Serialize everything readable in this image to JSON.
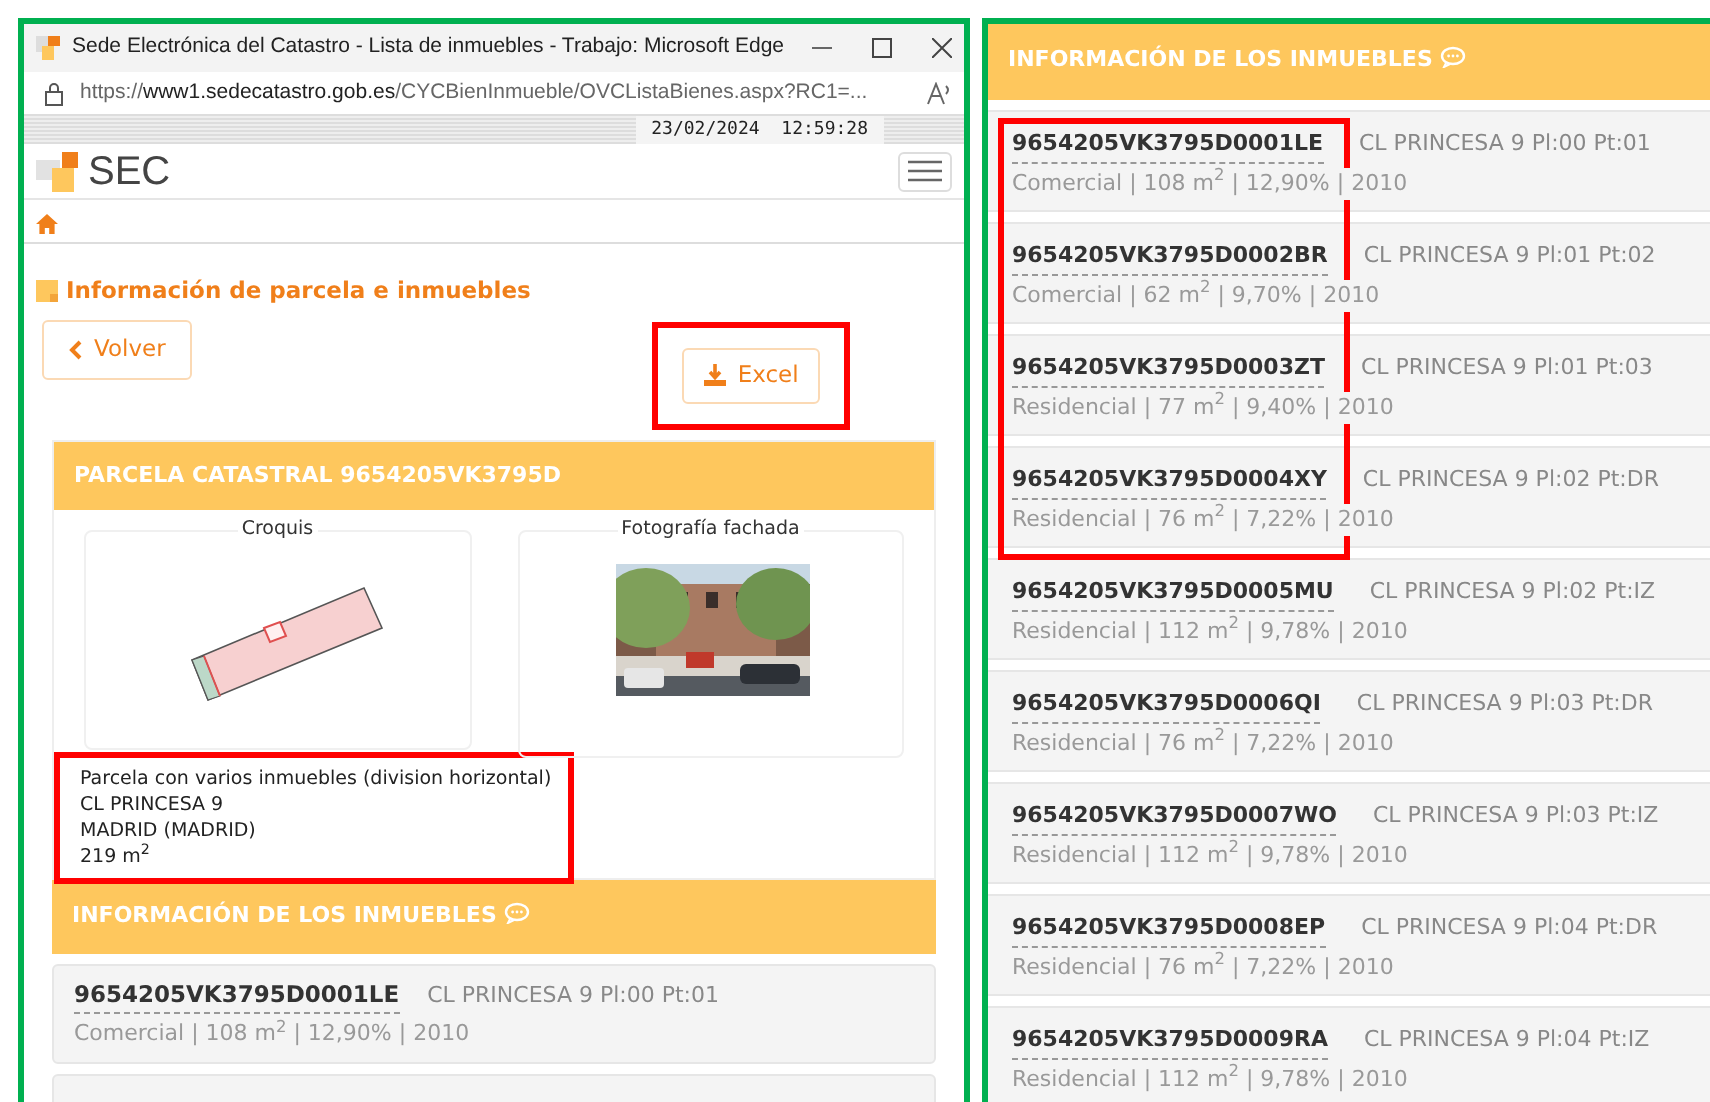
{
  "browser": {
    "title": "Sede Electrónica del Catastro - Lista de inmuebles - Trabajo: Microsoft Edge",
    "url_scheme": "https://",
    "url_host": "www1.sedecatastro.gob.es",
    "url_path": "/CYCBienInmueble/OVCListaBienes.aspx?RC1=...",
    "datetime": "23/02/2024  12:59:28"
  },
  "site": {
    "logo": "SEC",
    "section_title": "Información de parcela e inmuebles",
    "back_button": "Volver",
    "excel_button": {
      "label": "Excel",
      "highlighted": true
    }
  },
  "parcel": {
    "header": "PARCELA CATASTRAL 9654205VK3795D",
    "sketch_title": "Croquis",
    "photo_title": "Fotografía fachada",
    "info": {
      "highlighted": true,
      "lines": [
        "Parcela con varios inmuebles (division horizontal)",
        "CL PRINCESA 9",
        "MADRID (MADRID)",
        "219 m$^{2}$"
      ]
    }
  },
  "left_properties_header": "INFORMACIÓN DE LOS INMUEBLES",
  "right_properties_header": "INFORMACIÓN DE LOS INMUEBLES",
  "left_rows": [
    {
      "code": "9654205VK3795D0001LE",
      "address": "CL PRINCESA 9 Pl:00 Pt:01",
      "details": "Comercial | 108 m$^{2}$ | 12,90% | 2010"
    }
  ],
  "right_rows": [
    {
      "code": "9654205VK3795D0001LE",
      "address": "CL PRINCESA 9 Pl:00 Pt:01",
      "details": "Comercial | 108 m$^{2}$ | 12,90% | 2010",
      "highlighted": true
    },
    {
      "code": "9654205VK3795D0002BR",
      "address": "CL PRINCESA 9 Pl:01 Pt:02",
      "details": "Comercial | 62 m$^{2}$ | 9,70% | 2010",
      "highlighted": true
    },
    {
      "code": "9654205VK3795D0003ZT",
      "address": "CL PRINCESA 9 Pl:01 Pt:03",
      "details": "Residencial | 77 m$^{2}$ | 9,40% | 2010",
      "highlighted": true
    },
    {
      "code": "9654205VK3795D0004XY",
      "address": "CL PRINCESA 9 Pl:02 Pt:DR",
      "details": "Residencial | 76 m$^{2}$ | 7,22% | 2010",
      "highlighted": true
    },
    {
      "code": "9654205VK3795D0005MU",
      "address": "CL PRINCESA 9 Pl:02 Pt:IZ",
      "details": "Residencial | 112 m$^{2}$ | 9,78% | 2010",
      "highlighted": false
    },
    {
      "code": "9654205VK3795D0006QI",
      "address": "CL PRINCESA 9 Pl:03 Pt:DR",
      "details": "Residencial | 76 m$^{2}$ | 7,22% | 2010",
      "highlighted": false
    },
    {
      "code": "9654205VK3795D0007WO",
      "address": "CL PRINCESA 9 Pl:03 Pt:IZ",
      "details": "Residencial | 112 m$^{2}$ | 9,78% | 2010",
      "highlighted": false
    },
    {
      "code": "9654205VK3795D0008EP",
      "address": "CL PRINCESA 9 Pl:04 Pt:DR",
      "details": "Residencial | 76 m$^{2}$ | 7,22% | 2010",
      "highlighted": false
    },
    {
      "code": "9654205VK3795D0009RA",
      "address": "CL PRINCESA 9 Pl:04 Pt:IZ",
      "details": "Residencial | 112 m$^{2}$ | 9,78% | 2010",
      "highlighted": false
    }
  ]
}
